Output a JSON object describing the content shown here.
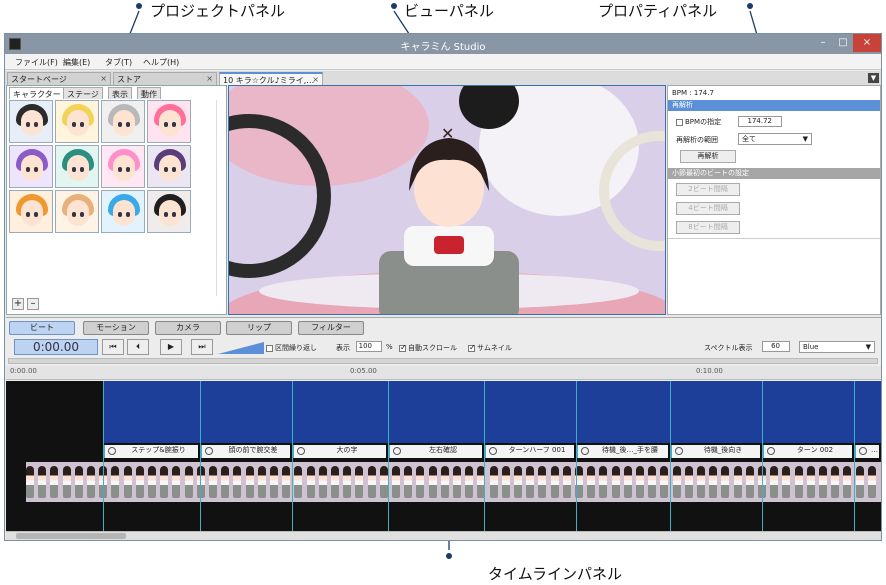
{
  "callouts": {
    "project": "プロジェクトパネル",
    "view": "ビューパネル",
    "property": "プロパティパネル",
    "timeline": "タイムラインパネル"
  },
  "window": {
    "title": "キャラミん Studio",
    "minimize": "–",
    "maximize": "□",
    "close": "×"
  },
  "menu": [
    "ファイル(F)",
    "編集(E)",
    "タブ(T)",
    "ヘルプ(H)"
  ],
  "tabs": [
    "スタートページ",
    "ストア",
    "10 キラ☆クル♪ミライ,…"
  ],
  "tab_dropdown": "▼",
  "project": {
    "tabs": [
      "キャラクター",
      "ステージ",
      "表示",
      "動作"
    ],
    "add": "+",
    "remove": "–",
    "characters": [
      {
        "hair": "#2a2a2a",
        "bg": "#e8eef8"
      },
      {
        "hair": "#f2d35a",
        "bg": "#fff4dc"
      },
      {
        "hair": "#b9b9b9",
        "bg": "#f0f0f0"
      },
      {
        "hair": "#ff6f9a",
        "bg": "#ffe3ee"
      },
      {
        "hair": "#8a5bc8",
        "bg": "#eee4fb"
      },
      {
        "hair": "#2a8f80",
        "bg": "#e2f5f1"
      },
      {
        "hair": "#ff8fc8",
        "bg": "#ffe8f4"
      },
      {
        "hair": "#5a3e7a",
        "bg": "#ece6f3"
      },
      {
        "hair": "#f09830",
        "bg": "#fff0de"
      },
      {
        "hair": "#e8b07a",
        "bg": "#fff3e6"
      },
      {
        "hair": "#3aa9e8",
        "bg": "#e3f3fd"
      },
      {
        "hair": "#1f1f1f",
        "bg": "#f0ecec"
      }
    ]
  },
  "props": {
    "bpm": "BPM : 174.7",
    "sect1": "再解析",
    "bpm_spec": "BPMの指定",
    "bpm_value": "174.72",
    "range_label": "再解析の範囲",
    "range_value": "全て",
    "reanalyze": "再解析",
    "sect2": "小節最初のビートの設定",
    "beat_buttons": [
      "2ビート間隔",
      "4ビート間隔",
      "8ビート間隔"
    ]
  },
  "timeline": {
    "tabs": [
      "ビート",
      "モーション",
      "カメラ",
      "リップ",
      "フィルター"
    ],
    "timecode": "0:00.00",
    "buttons": [
      "⏮",
      "⏴",
      "▶",
      "⏭"
    ],
    "loop": "区間繰り返し",
    "display": "表示",
    "display_value": "100",
    "percent": "%",
    "autoscroll": "自動スクロール",
    "thumbnail": "サムネイル",
    "spectrum": "スペクトル表示",
    "spectrum_value": "60",
    "color": "Blue",
    "ticks": [
      "0:00.00",
      "0:05.00",
      "0:10.00"
    ],
    "clips": [
      "ステップ&腕振り",
      "顔の前で腕交差",
      "大の字",
      "左右確認",
      "ターンハーフ 001",
      "待機_後…_手を腰",
      "待機_後向き",
      "ターン 002",
      "…"
    ]
  }
}
